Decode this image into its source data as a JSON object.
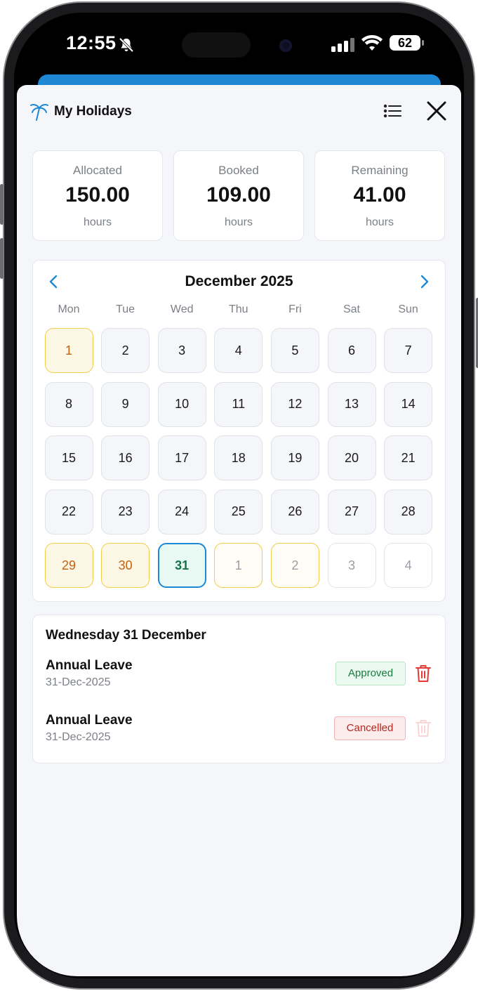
{
  "status_bar": {
    "time": "12:55",
    "battery": "62"
  },
  "header": {
    "title": "My Holidays"
  },
  "stats": [
    {
      "label": "Allocated",
      "value": "150.00",
      "unit": "hours"
    },
    {
      "label": "Booked",
      "value": "109.00",
      "unit": "hours"
    },
    {
      "label": "Remaining",
      "value": "41.00",
      "unit": "hours"
    }
  ],
  "calendar": {
    "month_label": "December 2025",
    "weekdays": [
      "Mon",
      "Tue",
      "Wed",
      "Thu",
      "Fri",
      "Sat",
      "Sun"
    ],
    "days": [
      {
        "label": "1",
        "state": "holiday"
      },
      {
        "label": "2",
        "state": "normal"
      },
      {
        "label": "3",
        "state": "normal"
      },
      {
        "label": "4",
        "state": "normal"
      },
      {
        "label": "5",
        "state": "normal"
      },
      {
        "label": "6",
        "state": "normal"
      },
      {
        "label": "7",
        "state": "normal"
      },
      {
        "label": "8",
        "state": "normal"
      },
      {
        "label": "9",
        "state": "normal"
      },
      {
        "label": "10",
        "state": "normal"
      },
      {
        "label": "11",
        "state": "normal"
      },
      {
        "label": "12",
        "state": "normal"
      },
      {
        "label": "13",
        "state": "normal"
      },
      {
        "label": "14",
        "state": "normal"
      },
      {
        "label": "15",
        "state": "normal"
      },
      {
        "label": "16",
        "state": "normal"
      },
      {
        "label": "17",
        "state": "normal"
      },
      {
        "label": "18",
        "state": "normal"
      },
      {
        "label": "19",
        "state": "normal"
      },
      {
        "label": "20",
        "state": "normal"
      },
      {
        "label": "21",
        "state": "normal"
      },
      {
        "label": "22",
        "state": "normal"
      },
      {
        "label": "23",
        "state": "normal"
      },
      {
        "label": "24",
        "state": "normal"
      },
      {
        "label": "25",
        "state": "normal"
      },
      {
        "label": "26",
        "state": "normal"
      },
      {
        "label": "27",
        "state": "normal"
      },
      {
        "label": "28",
        "state": "normal"
      },
      {
        "label": "29",
        "state": "holiday"
      },
      {
        "label": "30",
        "state": "holiday"
      },
      {
        "label": "31",
        "state": "selected"
      },
      {
        "label": "1",
        "state": "other-holiday"
      },
      {
        "label": "2",
        "state": "other-holiday"
      },
      {
        "label": "3",
        "state": "other"
      },
      {
        "label": "4",
        "state": "other"
      }
    ]
  },
  "details": {
    "title": "Wednesday 31 December",
    "entries": [
      {
        "type": "Annual Leave",
        "date": "31-Dec-2025",
        "status": "Approved",
        "deletable": true
      },
      {
        "type": "Annual Leave",
        "date": "31-Dec-2025",
        "status": "Cancelled",
        "deletable": false
      }
    ]
  },
  "colors": {
    "accent": "#1e88d4",
    "holiday_bg": "#fdf7e6",
    "holiday_border": "#f2cd4b",
    "holiday_text": "#c2610f",
    "selected_bg": "#e8f8f3",
    "selected_border": "#1e88d4",
    "selected_text": "#157347",
    "approved_bg": "#eafaf0",
    "approved_border": "#b6e6c6",
    "approved_text": "#1b7a3d",
    "cancelled_bg": "#fdecec",
    "cancelled_border": "#f1b3b3",
    "cancelled_text": "#b3261e",
    "delete_red": "#e53935"
  },
  "icons": {
    "header": "palm-tree-icon",
    "menu": "list-icon",
    "close": "close-icon",
    "prev": "chevron-left-icon",
    "next": "chevron-right-icon",
    "delete": "trash-icon"
  }
}
